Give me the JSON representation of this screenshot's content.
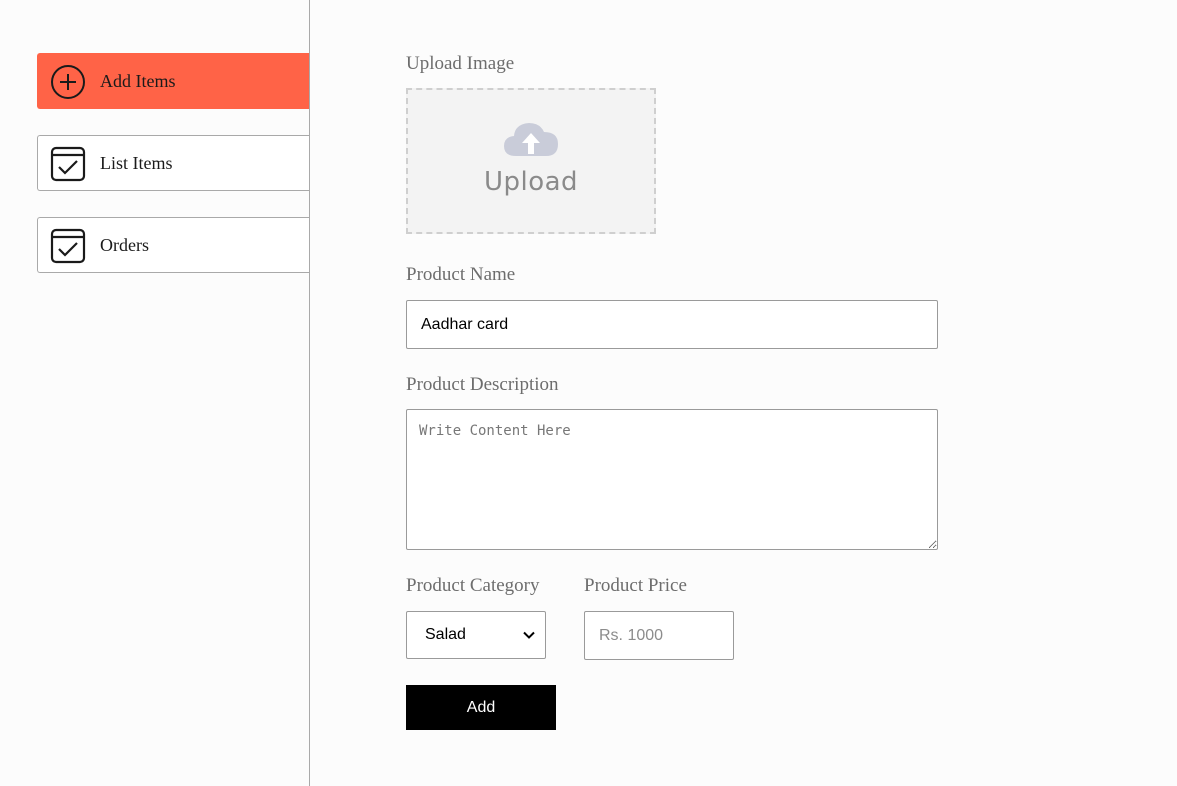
{
  "sidebar": {
    "items": [
      {
        "label": "Add Items",
        "icon": "add-circle-icon",
        "active": true
      },
      {
        "label": "List Items",
        "icon": "calendar-check-icon",
        "active": false
      },
      {
        "label": "Orders",
        "icon": "calendar-check-icon",
        "active": false
      }
    ]
  },
  "form": {
    "upload_label": "Upload Image",
    "upload_text": "Upload",
    "name_label": "Product Name",
    "name_value": "Aadhar card",
    "description_label": "Product Description",
    "description_placeholder": "Write Content Here",
    "category_label": "Product Category",
    "category_value": "Salad",
    "price_label": "Product Price",
    "price_placeholder": "Rs. 1000",
    "submit_label": "Add"
  },
  "colors": {
    "accent": "#ff6347",
    "button_bg": "#000000"
  }
}
